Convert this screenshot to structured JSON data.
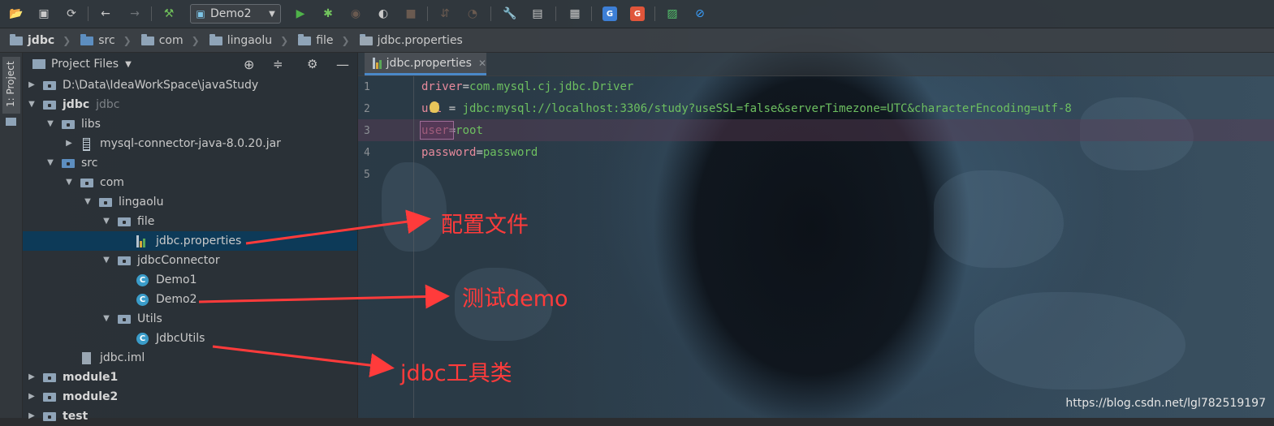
{
  "toolbar": {
    "run_config": "Demo2",
    "icons": [
      "open-icon",
      "save-icon",
      "sync-icon",
      "back-icon",
      "forward-icon",
      "build-icon",
      "run-icon",
      "debug-icon",
      "coverage-icon",
      "profile-icon",
      "stop-icon",
      "vcs-icon",
      "settings-icon",
      "structure-icon",
      "sdk-icon",
      "translate-icon",
      "translate-alt-icon",
      "monitor-icon",
      "block-icon"
    ],
    "translate_labels": [
      "G",
      "G"
    ]
  },
  "breadcrumb": [
    "jdbc",
    "src",
    "com",
    "lingaolu",
    "file",
    "jdbc.properties"
  ],
  "side_tab": "1: Project",
  "project_panel": {
    "title": "Project Files",
    "tree": [
      {
        "label": "D:\\Data\\IdeaWorkSpace\\javaStudy",
        "level": 0,
        "arrow": "right",
        "icon": "folder"
      },
      {
        "label": "jdbc",
        "extra": "jdbc",
        "level": 0,
        "arrow": "down",
        "icon": "module",
        "bold": true
      },
      {
        "label": "libs",
        "level": 1,
        "arrow": "down",
        "icon": "folder"
      },
      {
        "label": "mysql-connector-java-8.0.20.jar",
        "level": 2,
        "arrow": "right",
        "icon": "jar"
      },
      {
        "label": "src",
        "level": 1,
        "arrow": "down",
        "icon": "folder-blue"
      },
      {
        "label": "com",
        "level": 2,
        "arrow": "down",
        "icon": "package"
      },
      {
        "label": "lingaolu",
        "level": 3,
        "arrow": "down",
        "icon": "package"
      },
      {
        "label": "file",
        "level": 4,
        "arrow": "down",
        "icon": "package"
      },
      {
        "label": "jdbc.properties",
        "level": 5,
        "arrow": "",
        "icon": "props",
        "selected": true
      },
      {
        "label": "jdbcConnector",
        "level": 4,
        "arrow": "down",
        "icon": "package"
      },
      {
        "label": "Demo1",
        "level": 5,
        "arrow": "",
        "icon": "class"
      },
      {
        "label": "Demo2",
        "level": 5,
        "arrow": "",
        "icon": "class"
      },
      {
        "label": "Utils",
        "level": 4,
        "arrow": "down",
        "icon": "package"
      },
      {
        "label": "JdbcUtils",
        "level": 5,
        "arrow": "",
        "icon": "class"
      },
      {
        "label": "jdbc.iml",
        "level": 2,
        "arrow": "",
        "icon": "iml"
      },
      {
        "label": "module1",
        "level": 0,
        "arrow": "right",
        "icon": "module",
        "bold": true
      },
      {
        "label": "module2",
        "level": 0,
        "arrow": "right",
        "icon": "module",
        "bold": true
      },
      {
        "label": "test",
        "level": 0,
        "arrow": "right",
        "icon": "module",
        "bold": true
      }
    ]
  },
  "editor": {
    "tab": "jdbc.properties",
    "lines": [
      {
        "n": "1",
        "key": "driver",
        "sep": "=",
        "value": "com.mysql.cj.jdbc.Driver"
      },
      {
        "n": "2",
        "key": "url",
        "sep": " = ",
        "value": "jdbc:mysql://localhost:3306/study?useSSL=false&serverTimezone=UTC&characterEncoding=utf-8"
      },
      {
        "n": "3",
        "key": "user",
        "sep": "=",
        "value": "root"
      },
      {
        "n": "4",
        "key": "password",
        "sep": "=",
        "value": "password"
      },
      {
        "n": "5",
        "key": "",
        "sep": "",
        "value": ""
      }
    ]
  },
  "annotations": {
    "config_file": "配置文件",
    "test_demo": "测试demo",
    "jdbc_utils": "jdbc工具类",
    "color": "#ff3b3b"
  },
  "watermark": "https://blog.csdn.net/lgl782519197"
}
